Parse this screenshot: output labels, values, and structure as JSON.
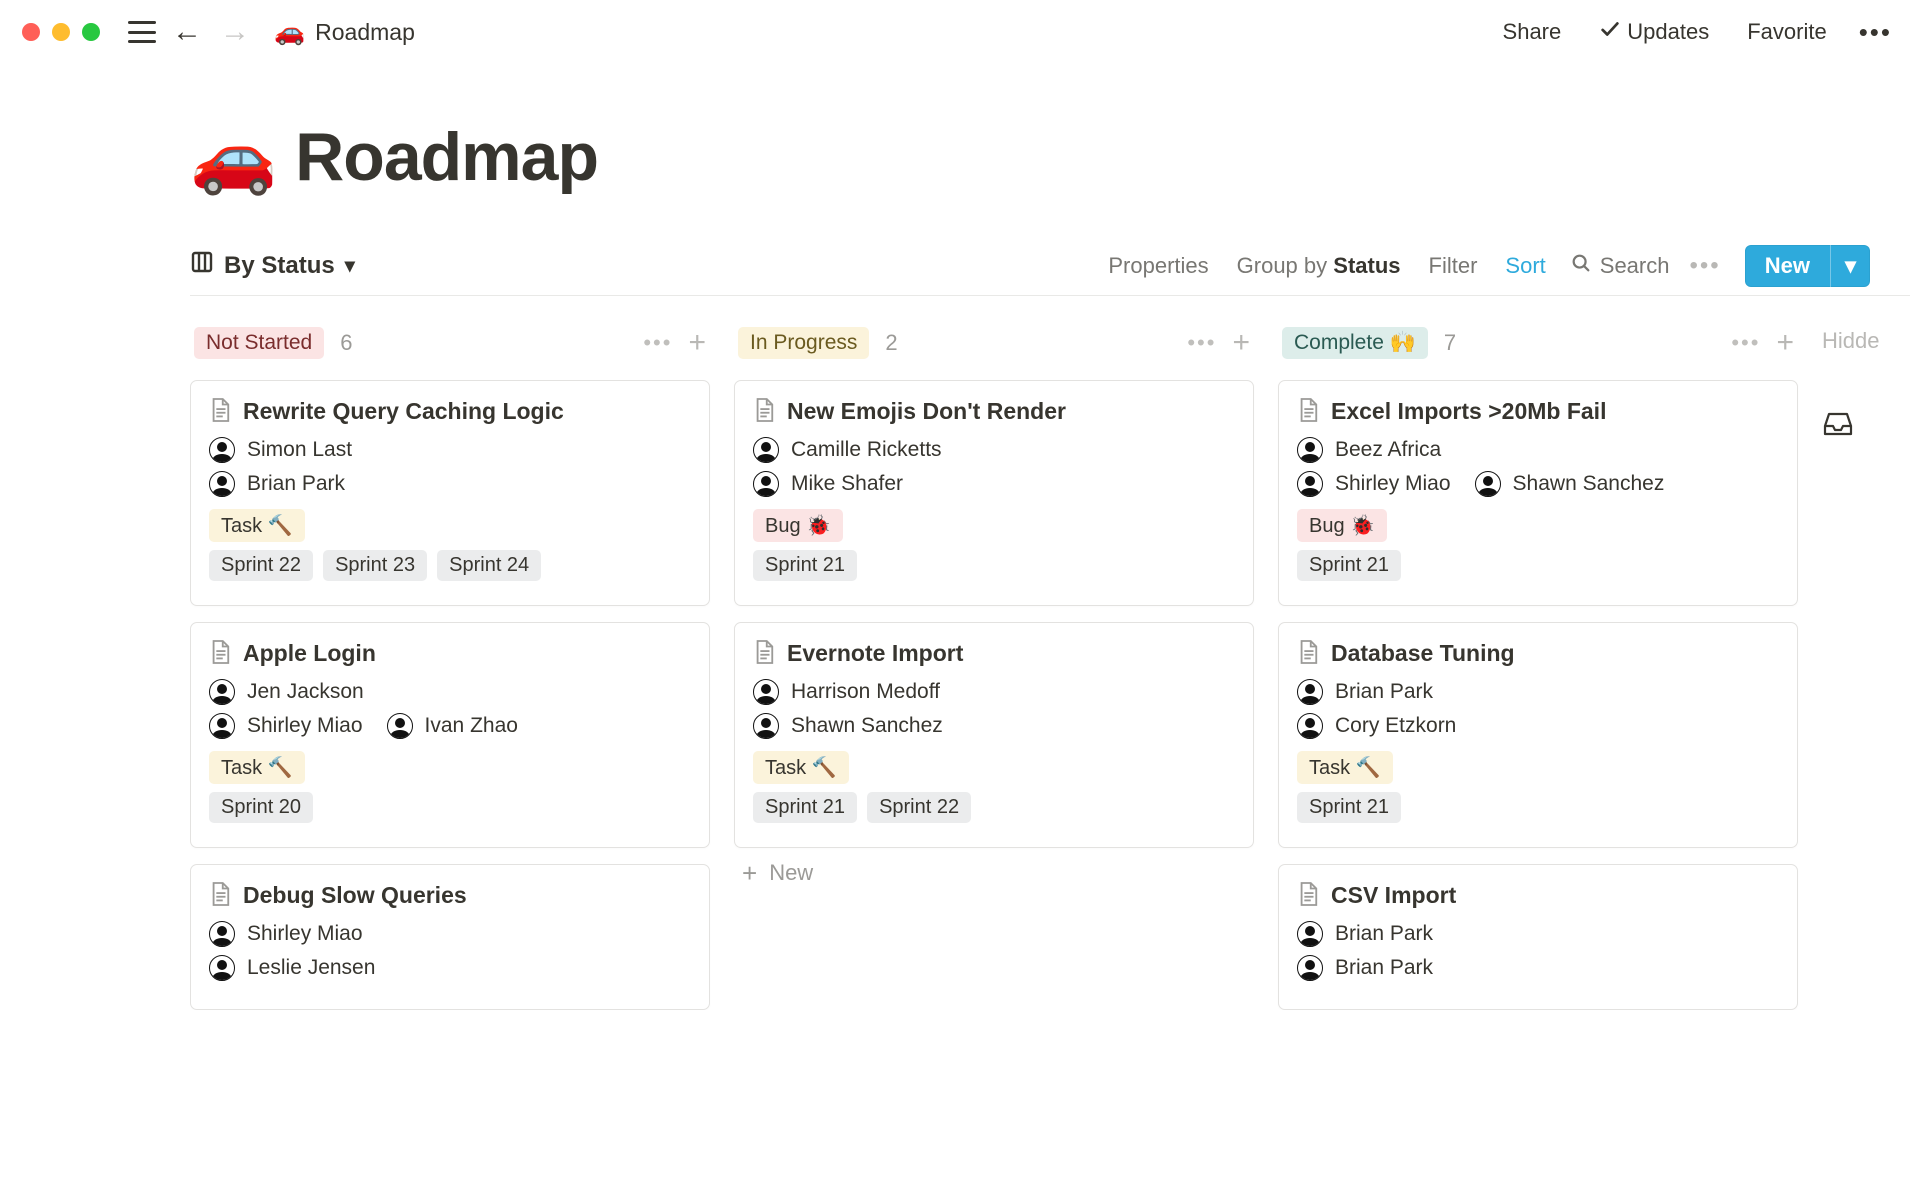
{
  "window": {
    "breadcrumb_emoji": "🚗",
    "breadcrumb_title": "Roadmap",
    "share": "Share",
    "updates": "Updates",
    "favorite": "Favorite"
  },
  "page": {
    "emoji": "🚗",
    "title": "Roadmap"
  },
  "toolbar": {
    "view_label": "By Status",
    "properties": "Properties",
    "groupby_prefix": "Group by",
    "groupby_value": "Status",
    "filter": "Filter",
    "sort": "Sort",
    "search": "Search",
    "new_label": "New"
  },
  "board": {
    "hidden_label": "Hidde",
    "new_row_label": "New",
    "columns": [
      {
        "status": "Not Started",
        "pill": "red",
        "count": "6",
        "cards": [
          {
            "title": "Rewrite Query Caching Logic",
            "people": [
              [
                "Simon Last"
              ],
              [
                "Brian Park"
              ]
            ],
            "kind": "Task 🔨",
            "kind_class": "task",
            "sprints": [
              "Sprint 22",
              "Sprint 23",
              "Sprint 24"
            ]
          },
          {
            "title": "Apple Login",
            "people": [
              [
                "Jen Jackson"
              ],
              [
                "Shirley Miao",
                "Ivan Zhao"
              ]
            ],
            "kind": "Task 🔨",
            "kind_class": "task",
            "sprints": [
              "Sprint 20"
            ]
          },
          {
            "title": "Debug Slow Queries",
            "people": [
              [
                "Shirley Miao"
              ],
              [
                "Leslie Jensen"
              ]
            ],
            "kind": "",
            "kind_class": "",
            "sprints": []
          }
        ]
      },
      {
        "status": "In Progress",
        "pill": "yellow",
        "count": "2",
        "cards": [
          {
            "title": "New Emojis Don't Render",
            "people": [
              [
                "Camille Ricketts"
              ],
              [
                "Mike Shafer"
              ]
            ],
            "kind": "Bug 🐞",
            "kind_class": "bug",
            "sprints": [
              "Sprint 21"
            ]
          },
          {
            "title": "Evernote Import",
            "people": [
              [
                "Harrison Medoff"
              ],
              [
                "Shawn Sanchez"
              ]
            ],
            "kind": "Task 🔨",
            "kind_class": "task",
            "sprints": [
              "Sprint 21",
              "Sprint 22"
            ]
          }
        ],
        "show_new_row": true
      },
      {
        "status": "Complete 🙌",
        "pill": "green",
        "count": "7",
        "cards": [
          {
            "title": "Excel Imports >20Mb Fail",
            "people": [
              [
                "Beez Africa"
              ],
              [
                "Shirley Miao",
                "Shawn Sanchez"
              ]
            ],
            "kind": "Bug 🐞",
            "kind_class": "bug",
            "sprints": [
              "Sprint 21"
            ]
          },
          {
            "title": "Database Tuning",
            "people": [
              [
                "Brian Park"
              ],
              [
                "Cory Etzkorn"
              ]
            ],
            "kind": "Task 🔨",
            "kind_class": "task",
            "sprints": [
              "Sprint 21"
            ]
          },
          {
            "title": "CSV Import",
            "people": [
              [
                "Brian Park"
              ],
              [
                "Brian Park"
              ]
            ],
            "kind": "",
            "kind_class": "",
            "sprints": []
          }
        ]
      }
    ]
  }
}
